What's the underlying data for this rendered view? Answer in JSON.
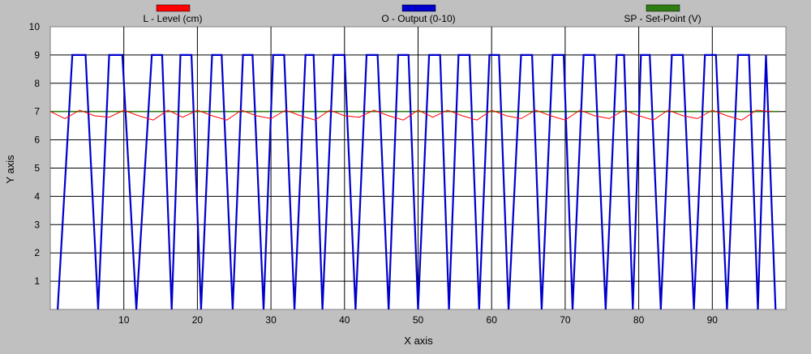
{
  "chart_data": {
    "type": "line",
    "xlabel": "X axis",
    "ylabel": "Y axis",
    "xlim": [
      0,
      100
    ],
    "ylim": [
      0,
      10
    ],
    "x_ticks": [
      10,
      20,
      30,
      40,
      50,
      60,
      70,
      80,
      90
    ],
    "y_ticks": [
      1,
      2,
      3,
      4,
      5,
      6,
      7,
      8,
      9,
      10
    ],
    "grid": true,
    "legend_position": "top",
    "series": [
      {
        "name": "L - Level (cm)",
        "color": "#ff0000",
        "x": [
          0,
          2,
          4,
          6,
          8,
          10,
          12,
          14,
          16,
          18,
          20,
          22,
          24,
          26,
          28,
          30,
          32,
          34,
          36,
          38,
          40,
          42,
          44,
          46,
          48,
          50,
          52,
          54,
          56,
          58,
          60,
          62,
          64,
          66,
          68,
          70,
          72,
          74,
          76,
          78,
          80,
          82,
          84,
          86,
          88,
          90,
          92,
          94,
          96,
          98
        ],
        "values": [
          7.0,
          6.75,
          7.05,
          6.85,
          6.8,
          7.05,
          6.85,
          6.7,
          7.05,
          6.8,
          7.05,
          6.85,
          6.7,
          7.05,
          6.85,
          6.75,
          7.05,
          6.85,
          6.7,
          7.05,
          6.85,
          6.8,
          7.05,
          6.85,
          6.7,
          7.05,
          6.8,
          7.05,
          6.85,
          6.7,
          7.05,
          6.85,
          6.75,
          7.05,
          6.85,
          6.7,
          7.05,
          6.85,
          6.75,
          7.05,
          6.85,
          6.7,
          7.05,
          6.85,
          6.75,
          7.05,
          6.85,
          6.7,
          7.05,
          7.0
        ]
      },
      {
        "name": "O - Output (0-10)",
        "color": "#0000cc",
        "x": [
          1.0,
          3.0,
          4.8,
          6.5,
          8.0,
          9.8,
          11.7,
          13.8,
          15.2,
          16.5,
          17.7,
          19.2,
          20.5,
          22.0,
          23.3,
          24.8,
          26.2,
          27.5,
          29.0,
          30.3,
          31.8,
          33.2,
          34.7,
          35.8,
          37.0,
          38.5,
          40.0,
          41.5,
          43.0,
          44.5,
          46.0,
          47.3,
          48.7,
          50.0,
          51.5,
          53.0,
          54.2,
          55.5,
          57.0,
          58.3,
          59.7,
          61.0,
          62.3,
          64.0,
          65.5,
          66.8,
          68.3,
          69.8,
          71.0,
          72.5,
          74.0,
          75.5,
          77.0,
          78.0,
          79.2,
          80.3,
          81.5,
          83.0,
          84.5,
          86.0,
          87.5,
          89.0,
          90.5,
          92.0,
          93.5,
          95.0,
          96.2,
          97.3,
          98.6
        ],
        "values": [
          0,
          9,
          9,
          0,
          9,
          9,
          0,
          9,
          9,
          0,
          9,
          9,
          0,
          9,
          9,
          0,
          9,
          9,
          0,
          9,
          9,
          0,
          9,
          9,
          0,
          9,
          9,
          0,
          9,
          9,
          0,
          9,
          9,
          0,
          9,
          9,
          0,
          9,
          9,
          0,
          9,
          9,
          0,
          9,
          9,
          0,
          9,
          9,
          0,
          9,
          9,
          0,
          9,
          9,
          0,
          9,
          9,
          0,
          9,
          9,
          0,
          9,
          9,
          0,
          9,
          9,
          0,
          9,
          0
        ]
      },
      {
        "name": "SP - Set-Point (V)",
        "color": "#2e7d12",
        "x": [
          0,
          99
        ],
        "values": [
          7,
          7
        ]
      }
    ]
  }
}
